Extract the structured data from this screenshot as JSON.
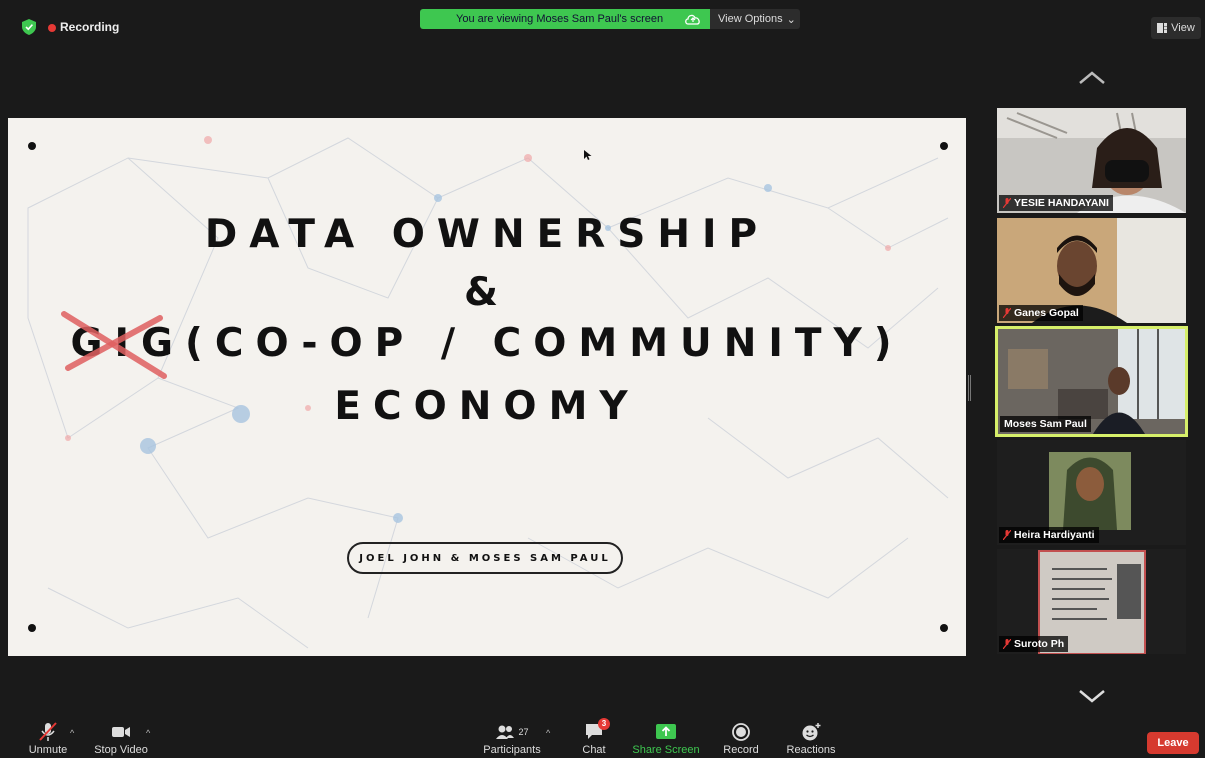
{
  "top": {
    "recording_label": "Recording",
    "banner_text": "You are viewing Moses Sam Paul's screen",
    "view_options_label": "View Options",
    "view_button_label": "View"
  },
  "slide": {
    "line1": "DATA OWNERSHIP",
    "line2": "&",
    "line3": "GIG(CO-OP / COMMUNITY)",
    "line4": "ECONOMY",
    "authors": "JOEL JOHN & MOSES SAM PAUL"
  },
  "participants": [
    {
      "name": "YESIE HANDAYANI",
      "muted": true,
      "active": false,
      "tone": "#c8c6c2"
    },
    {
      "name": "Ganes Gopal",
      "muted": true,
      "active": false,
      "tone": "#c9a77a"
    },
    {
      "name": "Moses Sam Paul",
      "muted": false,
      "active": true,
      "tone": "#6b6660"
    },
    {
      "name": "Heira Hardiyanti",
      "muted": true,
      "active": false,
      "tone": "#7d8a5e"
    },
    {
      "name": "Suroto Ph",
      "muted": true,
      "active": false,
      "tone": "#cfcac4"
    }
  ],
  "toolbar": {
    "unmute": "Unmute",
    "stop_video": "Stop Video",
    "participants": "Participants",
    "participants_count": "27",
    "chat": "Chat",
    "chat_badge": "3",
    "share_screen": "Share Screen",
    "record": "Record",
    "reactions": "Reactions",
    "leave": "Leave"
  },
  "colors": {
    "share_green": "#3ec750",
    "active_speaker": "#d6ef6a",
    "leave_red": "#d63a2f"
  }
}
